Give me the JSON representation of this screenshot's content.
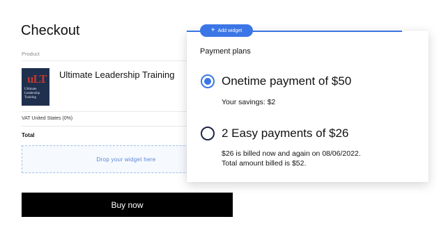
{
  "checkout": {
    "title": "Checkout",
    "product_label": "Product",
    "product": {
      "name": "Ultimate Leadership Training",
      "cover_mark": "uLT",
      "cover_text": "Ultimate Leadership Training"
    },
    "vat_label": "VAT United States (0%)",
    "total_label": "Total",
    "drop_zone_text": "Drop your widget here",
    "buy_button": "Buy now"
  },
  "widget_badge": {
    "icon": "plus-icon",
    "label": "Add widget",
    "color": "#3b76e6"
  },
  "payment_plans": {
    "title": "Payment plans",
    "options": [
      {
        "title": "Onetime payment of $50",
        "details": [
          "Your savings: $2"
        ],
        "selected": true
      },
      {
        "title": "2 Easy payments of $26",
        "details": [
          "$26 is billed now and again on 08/06/2022.",
          "Total amount billed is $52."
        ],
        "selected": false
      }
    ]
  },
  "colors": {
    "accent": "#3b76e6",
    "button_bg": "#000000",
    "book_cover": "#1f2f4e"
  }
}
